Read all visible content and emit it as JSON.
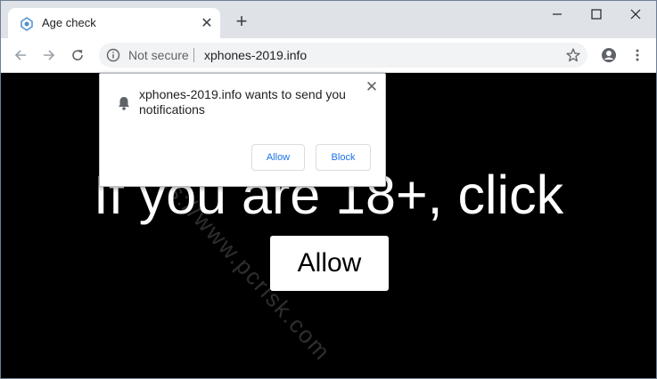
{
  "tab": {
    "title": "Age check",
    "favicon": "age-check-favicon-icon"
  },
  "toolbar": {
    "security_label": "Not secure",
    "url": "xphones-2019.info"
  },
  "page": {
    "headline": "If you are 18+, click",
    "allow_label": "Allow",
    "background": "#000000"
  },
  "popup": {
    "message": "xphones-2019.info wants to send you notifications",
    "allow_label": "Allow",
    "block_label": "Block",
    "button_text_color": "#1a73e8"
  },
  "watermark": "https://www.pcrisk.com"
}
